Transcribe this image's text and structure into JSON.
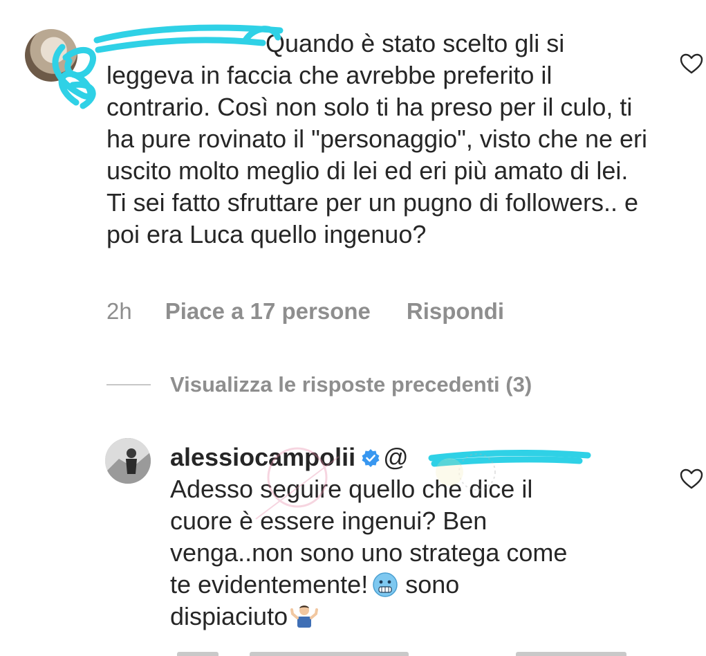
{
  "comment_1": {
    "text": "Quando è stato scelto gli si leggeva in faccia che avrebbe preferito il contrario. Così non solo ti ha preso per il culo, ti ha pure rovinato il \"personaggio\", visto che ne eri uscito molto meglio di lei ed eri più amato di lei. Ti sei fatto sfruttare per un pugno di followers.. e poi era Luca quello ingenuo?",
    "time": "2h",
    "likes": "Piace a 17 persone",
    "reply": "Rispondi"
  },
  "view_replies": {
    "label": "Visualizza le risposte precedenti (3)"
  },
  "comment_2": {
    "username": "alessiocampolii",
    "mention": "@",
    "text_line_1": "Adesso seguire quello che dice il",
    "text_line_2": "cuore è essere ingenui? Ben",
    "text_line_3": "venga..non sono uno stratega come",
    "text_line_4": "te evidentemente!",
    "text_after_emoji": " sono",
    "text_line_5": "dispiaciuto"
  },
  "icons": {
    "heart": "heart-outline-icon",
    "verified": "verified-badge-icon",
    "freezing_face": "freezing-face-emoji",
    "shrug": "person-shrugging-emoji"
  },
  "colors": {
    "text": "#262626",
    "meta": "#8e8e8e",
    "verified": "#3897f0",
    "scribble": "#2fd1e6"
  }
}
